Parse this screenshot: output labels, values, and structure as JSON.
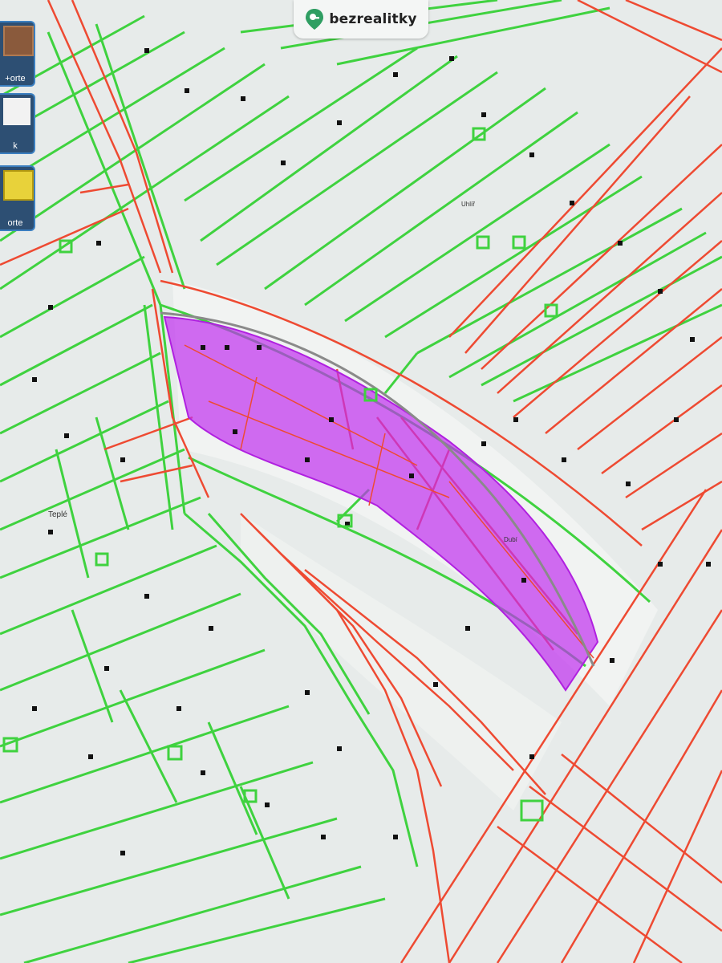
{
  "brand": {
    "name": "bezrealitky",
    "icon": "map-pin-key-icon",
    "color": "#2f9e62"
  },
  "tools": [
    {
      "name": "ortofoto",
      "label": "+orte"
    },
    {
      "name": "mapa",
      "label": "k"
    },
    {
      "name": "katastr",
      "label": "orte"
    }
  ],
  "places": {
    "town": "Teplé",
    "loc1": "Uhlíř",
    "loc2": "Dubí"
  },
  "colors": {
    "parcel_green": "#3fd23f",
    "parcel_red": "#ee4a32",
    "highlight": "#c12ff0",
    "road": "#8a8a8a"
  }
}
